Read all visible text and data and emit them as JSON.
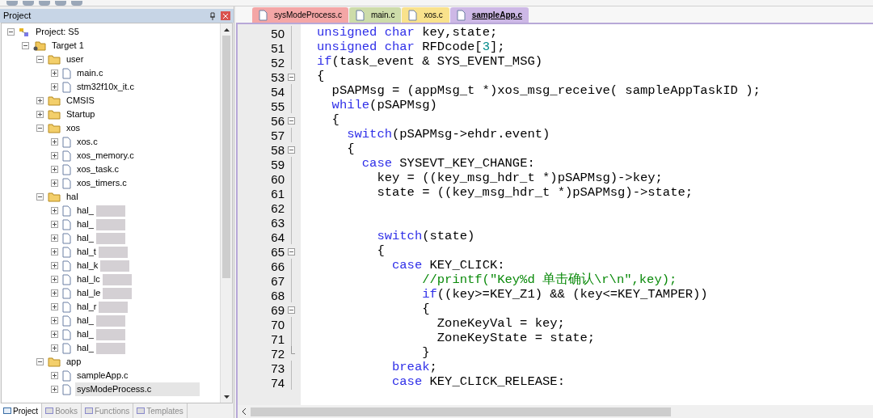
{
  "project_panel": {
    "title": "Project",
    "tree": [
      {
        "kind": "project",
        "label": "Project: S5",
        "expanded": true,
        "children": [
          {
            "kind": "target",
            "label": "Target 1",
            "expanded": true,
            "children": [
              {
                "kind": "folder",
                "label": "user",
                "expanded": true,
                "children": [
                  {
                    "kind": "file",
                    "label": "main.c",
                    "selected": false
                  },
                  {
                    "kind": "file",
                    "label": "stm32f10x_it.c",
                    "selected": false
                  }
                ]
              },
              {
                "kind": "folder",
                "label": "CMSIS",
                "expanded": false
              },
              {
                "kind": "folder",
                "label": "Startup",
                "expanded": false
              },
              {
                "kind": "folder",
                "label": "xos",
                "expanded": true,
                "children": [
                  {
                    "kind": "file",
                    "label": "xos.c",
                    "selected": false
                  },
                  {
                    "kind": "file",
                    "label": "xos_memory.c",
                    "selected": false
                  },
                  {
                    "kind": "file",
                    "label": "xos_task.c",
                    "selected": false
                  },
                  {
                    "kind": "file",
                    "label": "xos_timers.c",
                    "selected": false
                  }
                ]
              },
              {
                "kind": "folder",
                "label": "hal",
                "expanded": true,
                "children": [
                  {
                    "kind": "file",
                    "label": "hal_",
                    "selected": false,
                    "redacted": true
                  },
                  {
                    "kind": "file",
                    "label": "hal_",
                    "selected": false,
                    "redacted": true
                  },
                  {
                    "kind": "file",
                    "label": "hal_",
                    "selected": false,
                    "redacted": true
                  },
                  {
                    "kind": "file",
                    "label": "hal_t",
                    "selected": false,
                    "redacted": true
                  },
                  {
                    "kind": "file",
                    "label": "hal_k",
                    "selected": false,
                    "redacted": true
                  },
                  {
                    "kind": "file",
                    "label": "hal_lc",
                    "selected": false,
                    "redacted": true
                  },
                  {
                    "kind": "file",
                    "label": "hal_le",
                    "selected": false,
                    "redacted": true
                  },
                  {
                    "kind": "file",
                    "label": "hal_r",
                    "selected": false,
                    "redacted": true
                  },
                  {
                    "kind": "file",
                    "label": "hal_",
                    "selected": false,
                    "redacted": true
                  },
                  {
                    "kind": "file",
                    "label": "hal_",
                    "selected": false,
                    "redacted": true
                  },
                  {
                    "kind": "file",
                    "label": "hal_",
                    "selected": false,
                    "redacted": true
                  }
                ]
              },
              {
                "kind": "folder",
                "label": "app",
                "expanded": true,
                "children": [
                  {
                    "kind": "file",
                    "label": "sampleApp.c",
                    "selected": false
                  },
                  {
                    "kind": "file",
                    "label": "sysModeProcess.c",
                    "selected": true
                  }
                ]
              }
            ]
          }
        ]
      }
    ],
    "bottom_tabs": [
      {
        "label": "Project",
        "selected": true
      },
      {
        "label": "Books",
        "selected": false
      },
      {
        "label": "Functions",
        "selected": false
      },
      {
        "label": "Templates",
        "selected": false
      }
    ]
  },
  "editor": {
    "tabs": [
      {
        "label": "sysModeProcess.c",
        "color": "#f4a6a6",
        "selected": false
      },
      {
        "label": "main.c",
        "color": "#cddcaa",
        "selected": false
      },
      {
        "label": "xos.c",
        "color": "#f9e28c",
        "selected": false
      },
      {
        "label": "sampleApp.c",
        "color": "#cdb8e6",
        "selected": true
      }
    ],
    "lines": [
      {
        "number": "50",
        "foldable": false,
        "fold_end": false,
        "tokens": [
          {
            "kind": "keyword",
            "text": "unsigned char"
          },
          {
            "kind": "plain",
            "text": " key,state;"
          }
        ]
      },
      {
        "number": "51",
        "foldable": false,
        "fold_end": false,
        "tokens": [
          {
            "kind": "keyword",
            "text": "unsigned char"
          },
          {
            "kind": "plain",
            "text": " RFDcode["
          },
          {
            "kind": "number",
            "text": "3"
          },
          {
            "kind": "plain",
            "text": "];"
          }
        ]
      },
      {
        "number": "52",
        "foldable": false,
        "fold_end": false,
        "tokens": [
          {
            "kind": "keyword",
            "text": "if"
          },
          {
            "kind": "plain",
            "text": "(task_event & SYS_EVENT_MSG)"
          }
        ]
      },
      {
        "number": "53",
        "foldable": true,
        "fold_end": false,
        "tokens": [
          {
            "kind": "plain",
            "text": "{"
          }
        ],
        "children": [
          {
            "number": "54",
            "foldable": false,
            "fold_end": false,
            "tokens": [
              {
                "kind": "plain",
                "text": "pSAPMsg = (appMsg_t *)xos_msg_receive( sampleAppTaskID );"
              }
            ]
          },
          {
            "number": "55",
            "foldable": false,
            "fold_end": false,
            "tokens": [
              {
                "kind": "keyword",
                "text": "while"
              },
              {
                "kind": "plain",
                "text": "(pSAPMsg)"
              }
            ]
          },
          {
            "number": "56",
            "foldable": true,
            "fold_end": false,
            "tokens": [
              {
                "kind": "plain",
                "text": "{"
              }
            ],
            "children": [
              {
                "number": "57",
                "foldable": false,
                "fold_end": false,
                "tokens": [
                  {
                    "kind": "keyword",
                    "text": "switch"
                  },
                  {
                    "kind": "plain",
                    "text": "(pSAPMsg->ehdr.event)"
                  }
                ]
              },
              {
                "number": "58",
                "foldable": true,
                "fold_end": false,
                "tokens": [
                  {
                    "kind": "plain",
                    "text": "{"
                  }
                ],
                "children": [
                  {
                    "number": "59",
                    "foldable": false,
                    "fold_end": false,
                    "tokens": [
                      {
                        "kind": "keyword",
                        "text": "case"
                      },
                      {
                        "kind": "plain",
                        "text": " SYSEVT_KEY_CHANGE:"
                      }
                    ],
                    "children": [
                      {
                        "number": "60",
                        "foldable": false,
                        "fold_end": false,
                        "tokens": [
                          {
                            "kind": "plain",
                            "text": "key = ((key_msg_hdr_t *)pSAPMsg)->key;"
                          }
                        ]
                      },
                      {
                        "number": "61",
                        "foldable": false,
                        "fold_end": false,
                        "tokens": [
                          {
                            "kind": "plain",
                            "text": "state = ((key_msg_hdr_t *)pSAPMsg)->state;"
                          }
                        ]
                      },
                      {
                        "number": "62",
                        "foldable": false,
                        "fold_end": false
                      },
                      {
                        "number": "63",
                        "foldable": false,
                        "fold_end": false
                      },
                      {
                        "number": "64",
                        "foldable": false,
                        "fold_end": false,
                        "tokens": [
                          {
                            "kind": "keyword",
                            "text": "switch"
                          },
                          {
                            "kind": "plain",
                            "text": "(state)"
                          }
                        ]
                      },
                      {
                        "number": "65",
                        "foldable": true,
                        "fold_end": false,
                        "tokens": [
                          {
                            "kind": "plain",
                            "text": "{"
                          }
                        ],
                        "children": [
                          {
                            "number": "66",
                            "foldable": false,
                            "fold_end": false,
                            "tokens": [
                              {
                                "kind": "keyword",
                                "text": "case"
                              },
                              {
                                "kind": "plain",
                                "text": " KEY_CLICK:"
                              }
                            ],
                            "children": [
                              {
                                "number": "67",
                                "foldable": false,
                                "fold_end": false,
                                "tokens": [
                                  {
                                    "kind": "comment",
                                    "text": "//printf(\"Key%d 单击确认\\r\\n\",key);"
                                  }
                                ]
                              },
                              {
                                "number": "68",
                                "foldable": false,
                                "fold_end": false,
                                "tokens": [
                                  {
                                    "kind": "keyword",
                                    "text": "if"
                                  },
                                  {
                                    "kind": "plain",
                                    "text": "((key>=KEY_Z1) && (key<=KEY_TAMPER))"
                                  }
                                ]
                              },
                              {
                                "number": "69",
                                "foldable": true,
                                "fold_end": false,
                                "tokens": [
                                  {
                                    "kind": "plain",
                                    "text": "{"
                                  }
                                ],
                                "children": [
                                  {
                                    "number": "70",
                                    "foldable": false,
                                    "fold_end": false,
                                    "tokens": [
                                      {
                                        "kind": "plain",
                                        "text": "ZoneKeyVal = key;"
                                      }
                                    ]
                                  },
                                  {
                                    "number": "71",
                                    "foldable": false,
                                    "fold_end": false,
                                    "tokens": [
                                      {
                                        "kind": "plain",
                                        "text": "ZoneKeyState = state;"
                                      }
                                    ]
                                  }
                                ]
                              },
                              {
                                "number": "72",
                                "foldable": false,
                                "fold_end": true,
                                "tokens": [
                                  {
                                    "kind": "plain",
                                    "text": "}"
                                  }
                                ]
                              }
                            ]
                          },
                          {
                            "number": "73",
                            "foldable": false,
                            "fold_end": false,
                            "tokens": [
                              {
                                "kind": "keyword",
                                "text": "break"
                              },
                              {
                                "kind": "plain",
                                "text": ";"
                              }
                            ]
                          },
                          {
                            "number": "74",
                            "foldable": false,
                            "fold_end": false,
                            "tokens": [
                              {
                                "kind": "keyword",
                                "text": "case"
                              },
                              {
                                "kind": "plain",
                                "text": " KEY_CLICK_RELEASE:"
                              }
                            ]
                          }
                        ]
                      }
                    ]
                  }
                ]
              }
            ]
          }
        ]
      }
    ]
  }
}
